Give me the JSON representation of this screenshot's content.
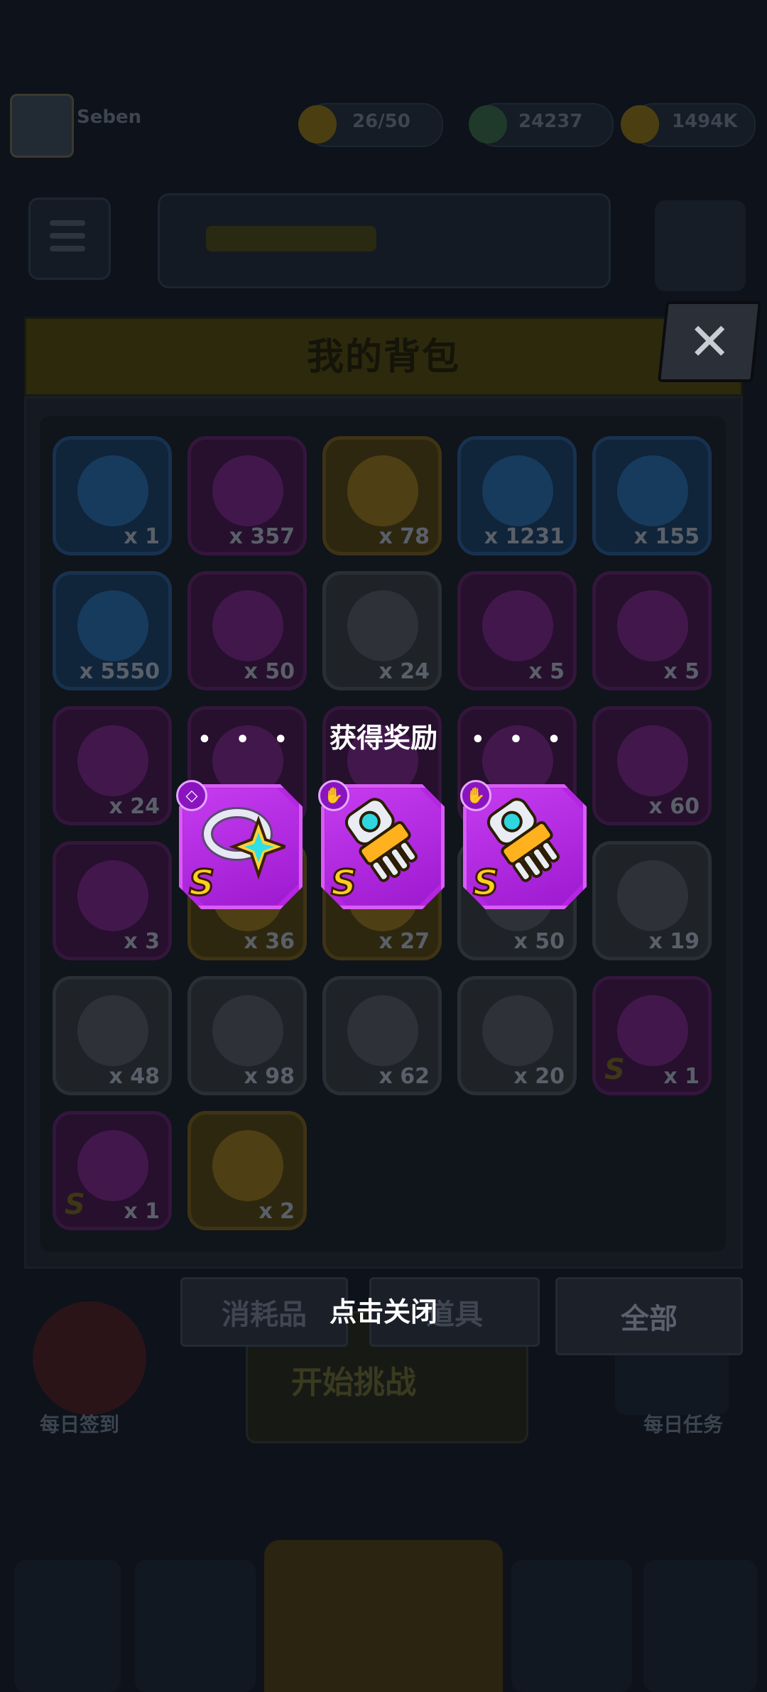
{
  "hud": {
    "player_name": "Seben",
    "energy": "26/50",
    "gems": "24237",
    "gold": "1494K"
  },
  "bag": {
    "title": "我的背包",
    "close_glyph": "✕",
    "items": [
      {
        "color": "blue",
        "icon": "key-icon",
        "count": "x 1"
      },
      {
        "color": "purple",
        "icon": "heart-coin-icon",
        "count": "x 357"
      },
      {
        "color": "gold",
        "icon": "gold-key-icon",
        "count": "x 78"
      },
      {
        "color": "blue",
        "icon": "flame-icon",
        "count": "x 1231"
      },
      {
        "color": "blue",
        "icon": "gold-coin-icon",
        "count": "x 155"
      },
      {
        "color": "blue",
        "icon": "pet-food-icon",
        "count": "x 5550"
      },
      {
        "color": "purple",
        "icon": "ticket-icon",
        "count": "x 50"
      },
      {
        "color": "gray",
        "icon": "cube-icon",
        "count": "x 24"
      },
      {
        "color": "purple",
        "icon": "ring-part-icon",
        "count": "x 5"
      },
      {
        "color": "purple",
        "icon": "orb-icon",
        "count": "x 5"
      },
      {
        "color": "purple",
        "icon": "puzzle-piece-icon",
        "count": "x 24"
      },
      {
        "color": "purple",
        "icon": "puzzle-piece-icon",
        "count": ""
      },
      {
        "color": "purple",
        "icon": "puzzle-piece-icon",
        "count": ""
      },
      {
        "color": "purple",
        "icon": "puzzle-piece-icon",
        "count": ""
      },
      {
        "color": "purple",
        "icon": "puzzle-piece-icon",
        "count": "x 60"
      },
      {
        "color": "purple",
        "icon": "puzzle-piece-icon",
        "count": "x 3"
      },
      {
        "color": "gold",
        "icon": "chest-icon",
        "count": "x 36"
      },
      {
        "color": "gold",
        "icon": "chest-icon",
        "count": "x 27"
      },
      {
        "color": "gray",
        "icon": "scroll-icon",
        "count": "x 50"
      },
      {
        "color": "gray",
        "icon": "shirt-scroll-icon",
        "count": "x 19"
      },
      {
        "color": "gray",
        "icon": "necklace-scroll-icon",
        "count": "x 48"
      },
      {
        "color": "gray",
        "icon": "belt-scroll-icon",
        "count": "x 98"
      },
      {
        "color": "gray",
        "icon": "glove-scroll-icon",
        "count": "x 62"
      },
      {
        "color": "gray",
        "icon": "book-scroll-icon",
        "count": "x 20"
      },
      {
        "color": "purple",
        "icon": "s-chest-icon",
        "count": "x 1",
        "grade": "S"
      },
      {
        "color": "purple",
        "icon": "s-box-icon",
        "count": "x 1",
        "grade": "S"
      },
      {
        "color": "gold",
        "icon": "shield-chest-icon",
        "count": "x 2"
      }
    ],
    "tabs": [
      {
        "label": "消耗品"
      },
      {
        "label": "道具"
      },
      {
        "label": "全部"
      }
    ]
  },
  "background": {
    "left_button_label": "每日签到",
    "center_button_label": "开始挑战",
    "right_button_label": "每日任务"
  },
  "reward_popup": {
    "title": "获得奖励",
    "dots": "• • •",
    "tap_to_close": "点击关闭",
    "rewards": [
      {
        "name": "ring-icon",
        "slot": "ring-slot-icon",
        "grade": "S",
        "color": "#b526e3"
      },
      {
        "name": "gauntlet-icon",
        "slot": "glove-slot-icon",
        "grade": "S",
        "color": "#b526e3"
      },
      {
        "name": "gauntlet-icon",
        "slot": "glove-slot-icon",
        "grade": "S",
        "color": "#b526e3"
      }
    ]
  }
}
